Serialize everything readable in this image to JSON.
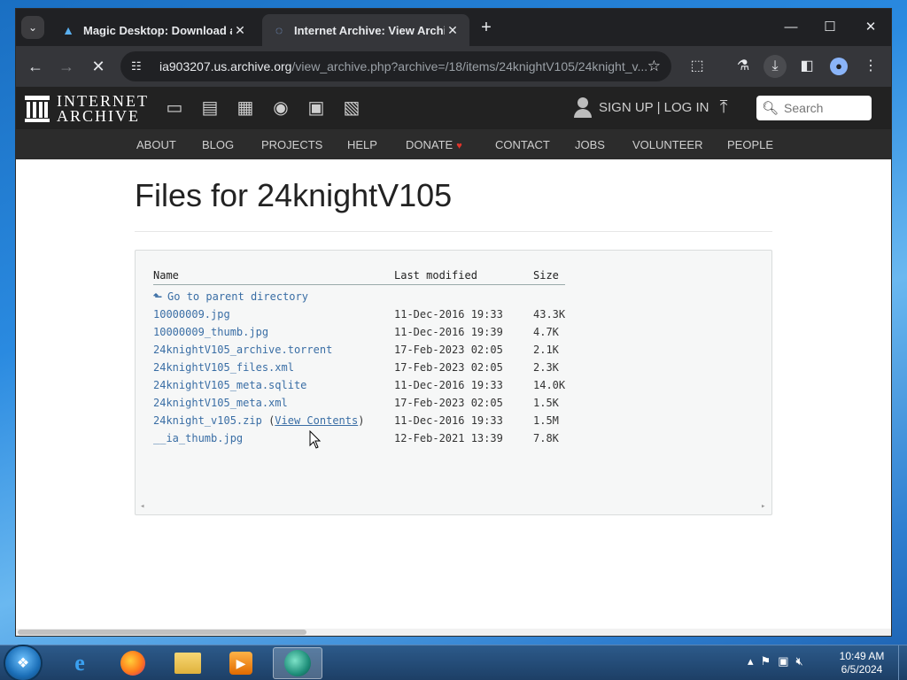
{
  "browser": {
    "tabs": [
      {
        "title": "Magic Desktop: Download and",
        "active": false
      },
      {
        "title": "Internet Archive: View Archive",
        "active": true
      }
    ],
    "url_host": "ia903207.us.archive.org",
    "url_path": "/view_archive.php?archive=/18/items/24knightV105/24knight_v..."
  },
  "ia_header": {
    "logo_line1": "INTERNET",
    "logo_line2": "ARCHIVE",
    "media_icons": [
      "web-icon",
      "texts-icon",
      "video-icon",
      "audio-icon",
      "software-icon",
      "images-icon"
    ],
    "signup_label": "SIGN UP | LOG IN",
    "search_placeholder": "Search"
  },
  "ia_nav": {
    "items": [
      "ABOUT",
      "BLOG",
      "PROJECTS",
      "HELP",
      "DONATE",
      "CONTACT",
      "JOBS",
      "VOLUNTEER",
      "PEOPLE"
    ]
  },
  "page": {
    "title": "Files for 24knightV105"
  },
  "listing": {
    "headers": {
      "name": "Name",
      "modified": "Last modified",
      "size": "Size"
    },
    "parent_label": "Go to parent directory",
    "rows": [
      {
        "name": "10000009.jpg",
        "modified": "11-Dec-2016 19:33",
        "size": "43.3K"
      },
      {
        "name": "10000009_thumb.jpg",
        "modified": "11-Dec-2016 19:39",
        "size": "4.7K"
      },
      {
        "name": "24knightV105_archive.torrent",
        "modified": "17-Feb-2023 02:05",
        "size": "2.1K"
      },
      {
        "name": "24knightV105_files.xml",
        "modified": "17-Feb-2023 02:05",
        "size": "2.3K"
      },
      {
        "name": "24knightV105_meta.sqlite",
        "modified": "11-Dec-2016 19:33",
        "size": "14.0K"
      },
      {
        "name": "24knightV105_meta.xml",
        "modified": "17-Feb-2023 02:05",
        "size": "1.5K"
      },
      {
        "name": "24knight_v105.zip",
        "view_contents": "View Contents",
        "modified": "11-Dec-2016 19:33",
        "size": "1.5M"
      },
      {
        "name": "__ia_thumb.jpg",
        "modified": "12-Feb-2021 13:39",
        "size": "7.8K"
      }
    ]
  },
  "taskbar": {
    "clock_time": "10:49 AM",
    "clock_date": "6/5/2024"
  },
  "colors": {
    "link": "#3a6ea5",
    "ia_header_bg": "#222222",
    "donate_heart": "#e0342b"
  }
}
